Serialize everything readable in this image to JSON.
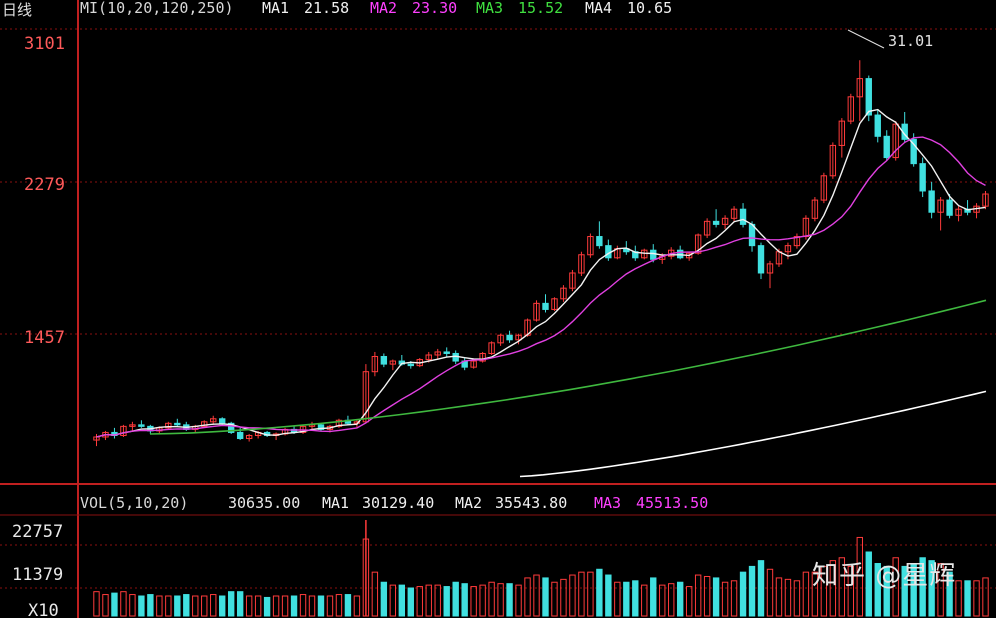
{
  "header": {
    "period_label": "日线",
    "ma_params": "MI(10,20,120,250)",
    "ma1": {
      "label": "MA1",
      "value": "21.58"
    },
    "ma2": {
      "label": "MA2",
      "value": "23.30"
    },
    "ma3": {
      "label": "MA3",
      "value": "15.52"
    },
    "ma4": {
      "label": "MA4",
      "value": "10.65"
    }
  },
  "price_axis": {
    "ticks": [
      "3101",
      "2279",
      "1457"
    ]
  },
  "peak_label": "31.01",
  "volume_header": {
    "params": "VOL(5,10,20)",
    "vol": "30635.00",
    "ma1": {
      "label": "MA1",
      "value": "30129.40"
    },
    "ma2": {
      "label": "MA2",
      "value": "35543.80"
    },
    "ma3": {
      "label": "MA3",
      "value": "45513.50"
    }
  },
  "volume_axis": {
    "ticks": [
      "22757",
      "11379",
      "X10"
    ]
  },
  "watermark": "知乎 @星辉",
  "colors": {
    "up": "#ff3b3b",
    "down": "#40e0e0",
    "ma1": "#f2f2f2",
    "ma2": "#e040e0",
    "ma3": "#3fb83f",
    "ma4": "#ffffff",
    "grid": "#8a1010",
    "axis": "#c02020",
    "label": "#ff5a5a",
    "hdr_ma1": "#f0f0f0",
    "hdr_ma2": "#ff40ff",
    "hdr_ma3": "#40e040",
    "hdr_ma4": "#f0f0f0"
  },
  "chart_data": {
    "type": "candlestick",
    "ylim": [
      350,
      3300
    ],
    "candles": [
      [
        600,
        640,
        560,
        620
      ],
      [
        620,
        660,
        600,
        650
      ],
      [
        650,
        680,
        610,
        630
      ],
      [
        630,
        700,
        620,
        690
      ],
      [
        690,
        720,
        660,
        700
      ],
      [
        700,
        730,
        680,
        690
      ],
      [
        690,
        700,
        640,
        660
      ],
      [
        660,
        690,
        640,
        680
      ],
      [
        680,
        720,
        670,
        710
      ],
      [
        710,
        740,
        690,
        700
      ],
      [
        700,
        720,
        660,
        670
      ],
      [
        670,
        700,
        650,
        690
      ],
      [
        690,
        730,
        680,
        720
      ],
      [
        720,
        760,
        700,
        740
      ],
      [
        740,
        750,
        700,
        710
      ],
      [
        710,
        720,
        640,
        650
      ],
      [
        650,
        680,
        600,
        610
      ],
      [
        610,
        640,
        590,
        630
      ],
      [
        630,
        660,
        610,
        650
      ],
      [
        650,
        660,
        620,
        630
      ],
      [
        630,
        650,
        600,
        640
      ],
      [
        640,
        680,
        630,
        670
      ],
      [
        670,
        690,
        640,
        650
      ],
      [
        650,
        700,
        640,
        690
      ],
      [
        690,
        720,
        670,
        700
      ],
      [
        700,
        710,
        660,
        670
      ],
      [
        670,
        700,
        650,
        690
      ],
      [
        690,
        740,
        680,
        730
      ],
      [
        730,
        760,
        700,
        710
      ],
      [
        710,
        730,
        680,
        720
      ],
      [
        720,
        1100,
        710,
        1050
      ],
      [
        1050,
        1180,
        1020,
        1150
      ],
      [
        1150,
        1170,
        1080,
        1100
      ],
      [
        1100,
        1130,
        1060,
        1120
      ],
      [
        1120,
        1160,
        1090,
        1100
      ],
      [
        1100,
        1120,
        1070,
        1090
      ],
      [
        1090,
        1140,
        1080,
        1130
      ],
      [
        1130,
        1180,
        1110,
        1160
      ],
      [
        1160,
        1200,
        1130,
        1180
      ],
      [
        1180,
        1210,
        1150,
        1170
      ],
      [
        1170,
        1190,
        1100,
        1120
      ],
      [
        1120,
        1140,
        1060,
        1080
      ],
      [
        1080,
        1130,
        1070,
        1120
      ],
      [
        1120,
        1180,
        1110,
        1170
      ],
      [
        1170,
        1250,
        1160,
        1240
      ],
      [
        1240,
        1300,
        1220,
        1290
      ],
      [
        1290,
        1320,
        1240,
        1260
      ],
      [
        1260,
        1300,
        1230,
        1290
      ],
      [
        1290,
        1400,
        1280,
        1390
      ],
      [
        1390,
        1520,
        1380,
        1500
      ],
      [
        1500,
        1560,
        1440,
        1460
      ],
      [
        1460,
        1540,
        1450,
        1530
      ],
      [
        1530,
        1620,
        1510,
        1600
      ],
      [
        1600,
        1720,
        1580,
        1700
      ],
      [
        1700,
        1840,
        1680,
        1820
      ],
      [
        1820,
        1960,
        1800,
        1940
      ],
      [
        1940,
        2040,
        1860,
        1880
      ],
      [
        1880,
        1920,
        1780,
        1800
      ],
      [
        1800,
        1880,
        1790,
        1860
      ],
      [
        1860,
        1910,
        1820,
        1840
      ],
      [
        1840,
        1880,
        1780,
        1800
      ],
      [
        1800,
        1860,
        1790,
        1850
      ],
      [
        1850,
        1890,
        1770,
        1790
      ],
      [
        1790,
        1830,
        1760,
        1810
      ],
      [
        1810,
        1870,
        1790,
        1850
      ],
      [
        1850,
        1880,
        1790,
        1800
      ],
      [
        1800,
        1840,
        1780,
        1830
      ],
      [
        1830,
        1960,
        1820,
        1950
      ],
      [
        1950,
        2060,
        1930,
        2040
      ],
      [
        2040,
        2120,
        2000,
        2020
      ],
      [
        2020,
        2080,
        1990,
        2060
      ],
      [
        2060,
        2140,
        2040,
        2120
      ],
      [
        2120,
        2160,
        2000,
        2020
      ],
      [
        2020,
        2040,
        1840,
        1880
      ],
      [
        1880,
        1900,
        1660,
        1700
      ],
      [
        1700,
        1780,
        1600,
        1760
      ],
      [
        1760,
        1860,
        1740,
        1840
      ],
      [
        1840,
        1900,
        1790,
        1880
      ],
      [
        1880,
        1960,
        1860,
        1940
      ],
      [
        1940,
        2080,
        1920,
        2060
      ],
      [
        2060,
        2200,
        2040,
        2180
      ],
      [
        2180,
        2360,
        2160,
        2340
      ],
      [
        2340,
        2560,
        2320,
        2540
      ],
      [
        2540,
        2720,
        2460,
        2700
      ],
      [
        2700,
        2880,
        2680,
        2860
      ],
      [
        2860,
        3101,
        2700,
        2980
      ],
      [
        2980,
        3000,
        2700,
        2740
      ],
      [
        2740,
        2780,
        2560,
        2600
      ],
      [
        2600,
        2640,
        2440,
        2460
      ],
      [
        2460,
        2700,
        2440,
        2680
      ],
      [
        2680,
        2760,
        2560,
        2580
      ],
      [
        2580,
        2620,
        2400,
        2420
      ],
      [
        2420,
        2460,
        2200,
        2240
      ],
      [
        2240,
        2300,
        2060,
        2100
      ],
      [
        2100,
        2200,
        1980,
        2180
      ],
      [
        2180,
        2220,
        2060,
        2080
      ],
      [
        2080,
        2140,
        2040,
        2120
      ],
      [
        2120,
        2180,
        2080,
        2100
      ],
      [
        2100,
        2160,
        2060,
        2140
      ],
      [
        2140,
        2240,
        2120,
        2220
      ]
    ],
    "volume_ylim": [
      0,
      30000
    ]
  }
}
